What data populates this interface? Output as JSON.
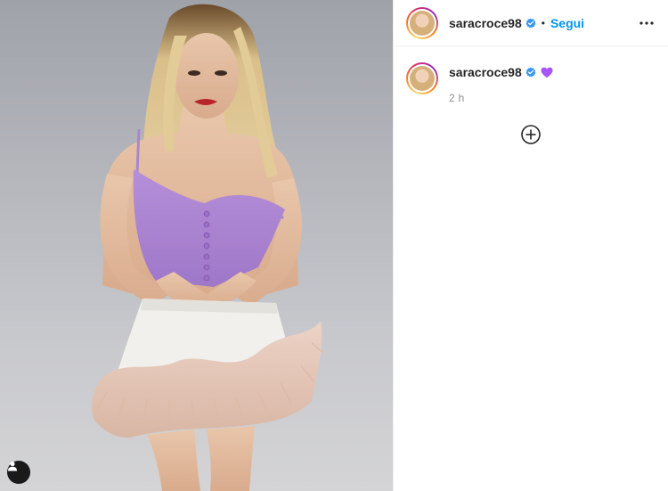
{
  "post": {
    "author": {
      "username": "saracroce98",
      "verified": true,
      "avatar": "profile-photo"
    },
    "header": {
      "separator": "•",
      "follow_label": "Segui",
      "more_icon": "more-horizontal-icon"
    },
    "caption": {
      "username": "saracroce98",
      "emoji": "purple-heart",
      "time": "2 h"
    },
    "load_more_icon": "circle-plus-icon",
    "media": {
      "type": "photo",
      "tag_icon": "user-tag-icon"
    },
    "colors": {
      "link": "#0095f6",
      "verified": "#3897f0",
      "heart": "#a855f7",
      "muted": "#8e8e8e"
    }
  }
}
